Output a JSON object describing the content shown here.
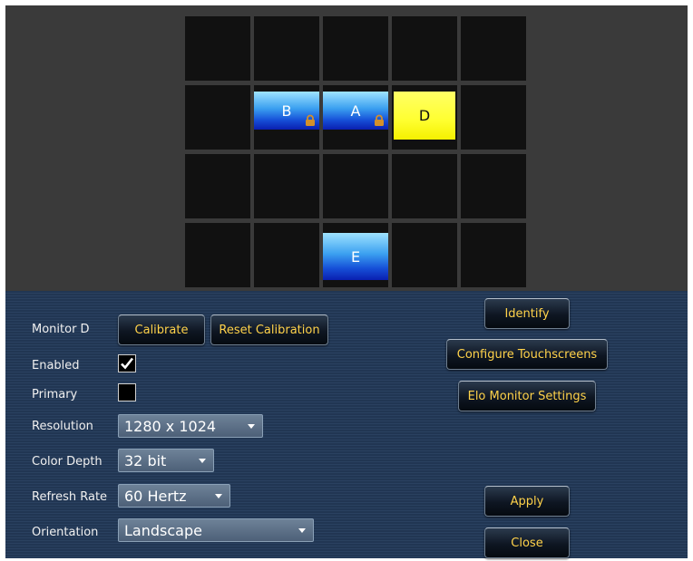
{
  "monitors": {
    "b": {
      "label": "B",
      "locked": true
    },
    "a": {
      "label": "A",
      "locked": true
    },
    "d": {
      "label": "D",
      "selected": true
    },
    "e": {
      "label": "E"
    }
  },
  "settings": {
    "title": "Monitor D",
    "calibrate_label": "Calibrate",
    "reset_calibration_label": "Reset Calibration",
    "enabled_label": "Enabled",
    "enabled_checked": true,
    "primary_label": "Primary",
    "primary_checked": false,
    "resolution_label": "Resolution",
    "resolution_value": "1280 x 1024",
    "color_depth_label": "Color Depth",
    "color_depth_value": "32 bit",
    "refresh_rate_label": "Refresh Rate",
    "refresh_rate_value": "60 Hertz",
    "orientation_label": "Orientation",
    "orientation_value": "Landscape"
  },
  "actions": {
    "identify_label": "Identify",
    "configure_touchscreens_label": "Configure Touchscreens",
    "elo_monitor_settings_label": "Elo Monitor Settings",
    "apply_label": "Apply",
    "close_label": "Close"
  },
  "colors": {
    "button_text": "#ffd24a",
    "selected_monitor": "#ffff30",
    "monitor_blue": "#1650d8",
    "lock": "#d4902a"
  },
  "icons": [
    "lock-icon",
    "checkmark-icon",
    "chevron-down-icon"
  ]
}
